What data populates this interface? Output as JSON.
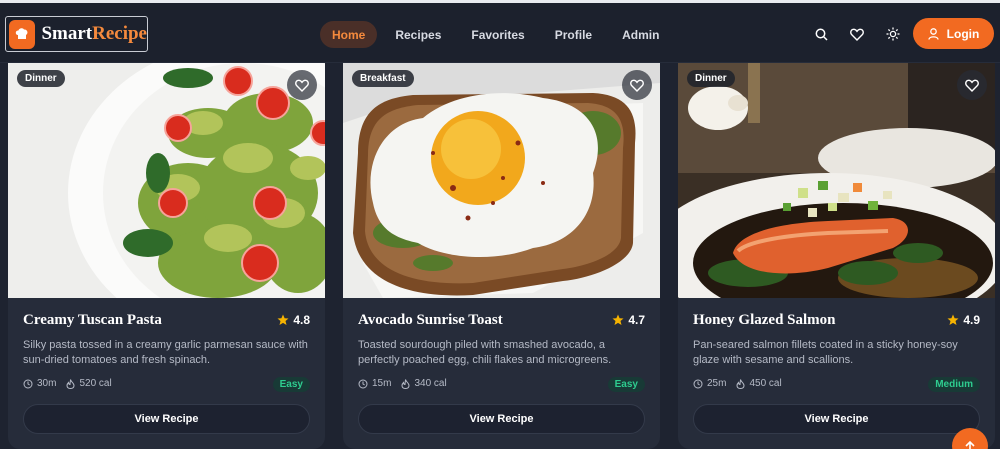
{
  "brand": {
    "part1": "Smart",
    "part2": "Recipe",
    "icon": "chef-hat-icon",
    "accent": "#f26a21"
  },
  "nav": [
    {
      "label": "Home",
      "active": true
    },
    {
      "label": "Recipes"
    },
    {
      "label": "Favorites"
    },
    {
      "label": "Profile"
    },
    {
      "label": "Admin"
    }
  ],
  "header_icons": [
    "search-icon",
    "heart-icon",
    "sun-icon"
  ],
  "login": {
    "label": "Login",
    "icon": "user-icon"
  },
  "view_label": "View Recipe",
  "recipes": [
    {
      "category": "Dinner",
      "title": "Creamy Tuscan Pasta",
      "rating": "4.8",
      "description": "Silky pasta tossed in a creamy garlic parmesan sauce with sun-dried tomatoes and fresh spinach.",
      "time": "30m",
      "calories": "520 cal",
      "difficulty": "Easy"
    },
    {
      "category": "Breakfast",
      "title": "Avocado Sunrise Toast",
      "rating": "4.7",
      "description": "Toasted sourdough piled with smashed avocado, a perfectly poached egg, chili flakes and microgreens.",
      "time": "15m",
      "calories": "340 cal",
      "difficulty": "Easy"
    },
    {
      "category": "Dinner",
      "title": "Honey Glazed Salmon",
      "rating": "4.9",
      "description": "Pan-seared salmon fillets coated in a sticky honey-soy glaze with sesame and scallions.",
      "time": "25m",
      "calories": "450 cal",
      "difficulty": "Medium"
    }
  ],
  "colors": {
    "background": "#1e2330",
    "card": "#262c3a",
    "accent": "#f26a21",
    "star": "#f5b301",
    "easy": "#2ecc8f",
    "medium": "#2ecc8f"
  }
}
